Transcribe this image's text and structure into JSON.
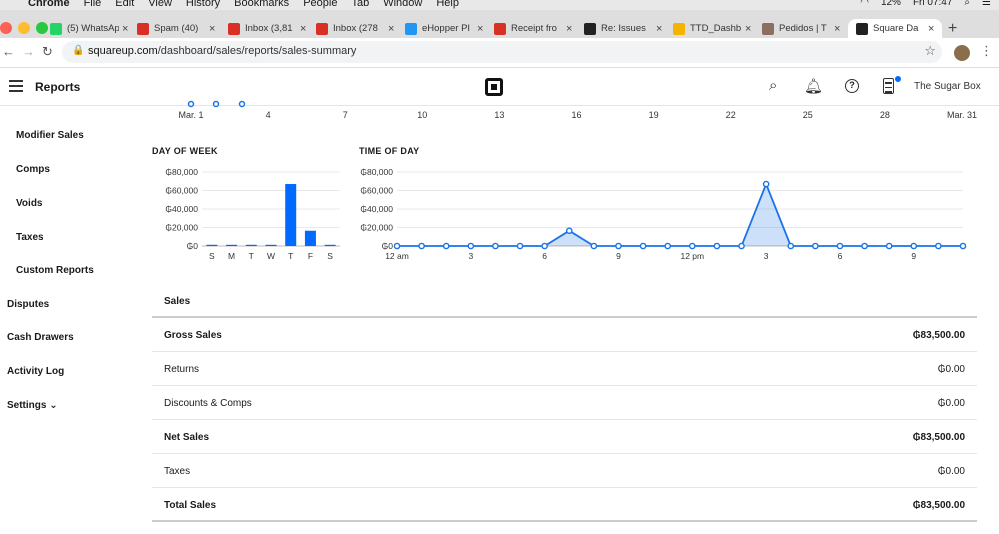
{
  "menubar": {
    "app": "Chrome",
    "menus": [
      "File",
      "Edit",
      "View",
      "History",
      "Bookmarks",
      "People",
      "Tab",
      "Window",
      "Help"
    ],
    "battery": "12%",
    "clock": "Fri 07:47"
  },
  "tabs": [
    {
      "label": "(5) WhatsApp",
      "icon": "whatsapp-icon",
      "color": "#25d366"
    },
    {
      "label": "Spam (40)",
      "icon": "gmail-icon",
      "color": "#d93025"
    },
    {
      "label": "Inbox (3,81",
      "icon": "gmail-icon",
      "color": "#d93025"
    },
    {
      "label": "Inbox (278",
      "icon": "gmail-icon",
      "color": "#d93025"
    },
    {
      "label": "eHopper PI",
      "icon": "ehopper-icon",
      "color": "#2196f3"
    },
    {
      "label": "Receipt fro",
      "icon": "gmail-icon",
      "color": "#d93025"
    },
    {
      "label": "Re: Issues",
      "icon": "square-icon",
      "color": "#222222"
    },
    {
      "label": "TTD_Dashb",
      "icon": "sheets-icon",
      "color": "#f4b400"
    },
    {
      "label": "Pedidos | T",
      "icon": "page-icon",
      "color": "#8d6e63"
    },
    {
      "label": "Square Da",
      "icon": "square-icon",
      "color": "#222222"
    }
  ],
  "address": {
    "domain": "squareup.com",
    "path": "/dashboard/sales/reports/sales-summary"
  },
  "header": {
    "title": "Reports",
    "merchant": "The Sugar Box"
  },
  "sidebar": {
    "sub_items": [
      "Modifier Sales",
      "Comps",
      "Voids",
      "Taxes",
      "Custom Reports"
    ],
    "items": [
      "Disputes",
      "Cash Drawers",
      "Activity Log"
    ],
    "settings": "Settings"
  },
  "top_axis": {
    "ticks": [
      "Mar. 1",
      "4",
      "7",
      "10",
      "13",
      "16",
      "19",
      "22",
      "25",
      "28",
      "Mar. 31"
    ]
  },
  "chart_data": [
    {
      "type": "bar",
      "title": "DAY OF WEEK",
      "categories": [
        "S",
        "M",
        "T",
        "W",
        "T",
        "F",
        "S"
      ],
      "values": [
        0,
        0,
        0,
        0,
        67000,
        16500,
        0
      ],
      "ytick_labels": [
        "₲0",
        "₲20,000",
        "₲40,000",
        "₲60,000",
        "₲80,000"
      ],
      "ylim": [
        0,
        80000
      ],
      "grid": true,
      "color": "#006aff"
    },
    {
      "type": "area",
      "title": "TIME OF DAY",
      "x": [
        0,
        1,
        2,
        3,
        4,
        5,
        6,
        7,
        8,
        9,
        10,
        11,
        12,
        13,
        14,
        15,
        16,
        17,
        18,
        19,
        20,
        21,
        22,
        23
      ],
      "values": [
        0,
        0,
        0,
        0,
        0,
        0,
        0,
        16500,
        0,
        0,
        0,
        0,
        0,
        0,
        0,
        67000,
        0,
        0,
        0,
        0,
        0,
        0,
        0,
        0
      ],
      "xtick_labels": [
        "12 am",
        "3",
        "6",
        "9",
        "12 pm",
        "3",
        "6",
        "9"
      ],
      "ytick_labels": [
        "₲0",
        "₲20,000",
        "₲40,000",
        "₲60,000",
        "₲80,000"
      ],
      "ylim": [
        0,
        80000
      ],
      "grid": true,
      "color": "#1a73e8"
    }
  ],
  "sales": {
    "title": "Sales",
    "rows": [
      {
        "label": "Gross Sales",
        "value": "₲83,500.00"
      },
      {
        "label": "Returns",
        "value": "₲0.00"
      },
      {
        "label": "Discounts & Comps",
        "value": "₲0.00"
      },
      {
        "label": "Net Sales",
        "value": "₲83,500.00"
      },
      {
        "label": "Taxes",
        "value": "₲0.00"
      },
      {
        "label": "Total Sales",
        "value": "₲83,500.00"
      }
    ]
  }
}
